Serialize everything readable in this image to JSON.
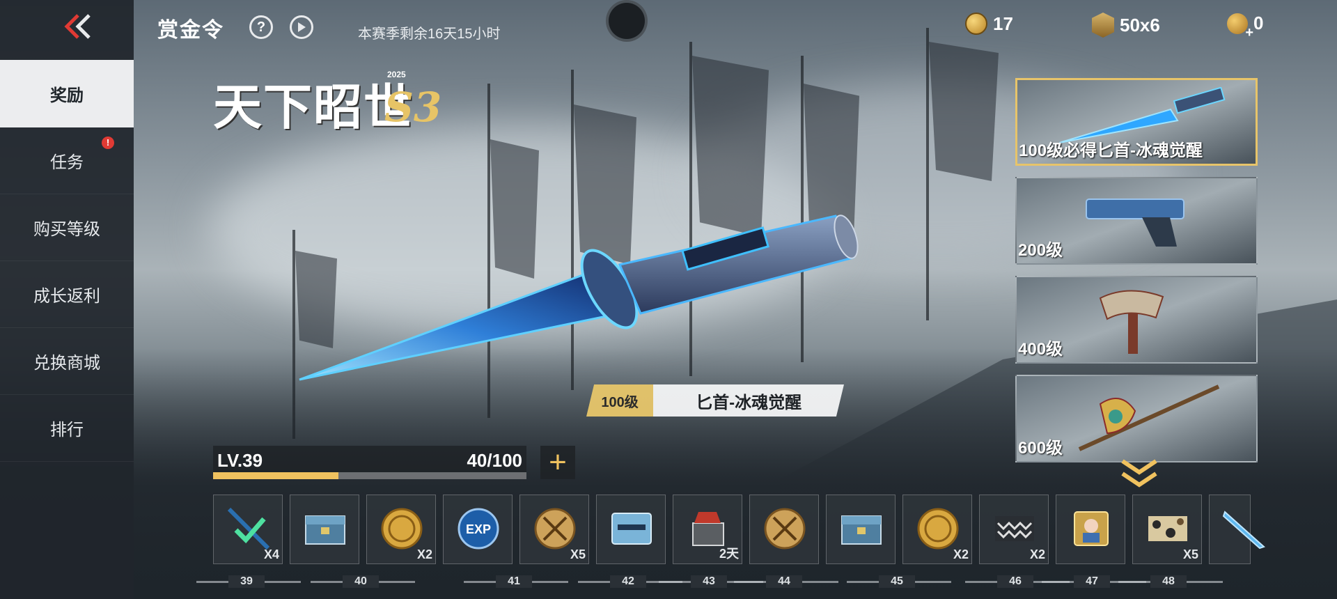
{
  "header": {
    "title": "赏金令",
    "help_icon": "?",
    "season_remaining": "本赛季剩余16天15小时"
  },
  "currencies": [
    {
      "icon": "gold-coin-icon",
      "value": "17"
    },
    {
      "icon": "badge-icon",
      "value": "50x6"
    },
    {
      "icon": "star-coin-icon",
      "value": "0"
    }
  ],
  "sidebar": {
    "items": [
      {
        "label": "奖励",
        "active": true
      },
      {
        "label": "任务",
        "badge": "!"
      },
      {
        "label": "购买等级"
      },
      {
        "label": "成长返利"
      },
      {
        "label": "兑换商城"
      },
      {
        "label": "排行"
      }
    ]
  },
  "logo": {
    "text": "天下昭世",
    "season": "S3",
    "year": "2025"
  },
  "hero": {
    "level": "100级",
    "name": "匕首-冰魂觉醒"
  },
  "rewards": [
    {
      "label": "100级必得匕首-冰魂觉醒",
      "active": true,
      "icon": "dagger-icon"
    },
    {
      "label": "200级",
      "icon": "pistol-icon"
    },
    {
      "label": "400级",
      "icon": "axe-icon"
    },
    {
      "label": "600级",
      "icon": "halberd-icon"
    }
  ],
  "level_bar": {
    "level": "LV.39",
    "progress": "40/100",
    "fill_fraction": 0.4
  },
  "track": {
    "slots": [
      {
        "icon": "dagger-claimed-icon",
        "qty": "X4",
        "claimed": true
      },
      {
        "icon": "crate-icon",
        "qty": ""
      },
      {
        "icon": "gold-coin-icon",
        "qty": "X2"
      },
      {
        "icon": "exp-card-icon",
        "qty": ""
      },
      {
        "icon": "crossed-rifles-coin-icon",
        "qty": "X5"
      },
      {
        "icon": "weapon-card-icon",
        "qty": ""
      },
      {
        "icon": "gift-box-icon",
        "qty": "2天"
      },
      {
        "icon": "crossed-rifles-coin-icon",
        "qty": ""
      },
      {
        "icon": "crate-icon",
        "qty": ""
      },
      {
        "icon": "gold-coin-icon",
        "qty": "X2"
      },
      {
        "icon": "chevron-pattern-icon",
        "qty": "X2"
      },
      {
        "icon": "avatar-card-icon",
        "qty": ""
      },
      {
        "icon": "camo-pattern-icon",
        "qty": "X5"
      },
      {
        "icon": "blade-icon",
        "qty": ""
      }
    ],
    "levels": [
      "39",
      "40",
      "41",
      "42",
      "43",
      "44",
      "45",
      "46",
      "47",
      "48"
    ]
  },
  "colors": {
    "accent": "#f0c25f",
    "sidebar_active": "#ecedef",
    "notification": "#e03a34",
    "dagger_blue": "#2fa7ff"
  }
}
